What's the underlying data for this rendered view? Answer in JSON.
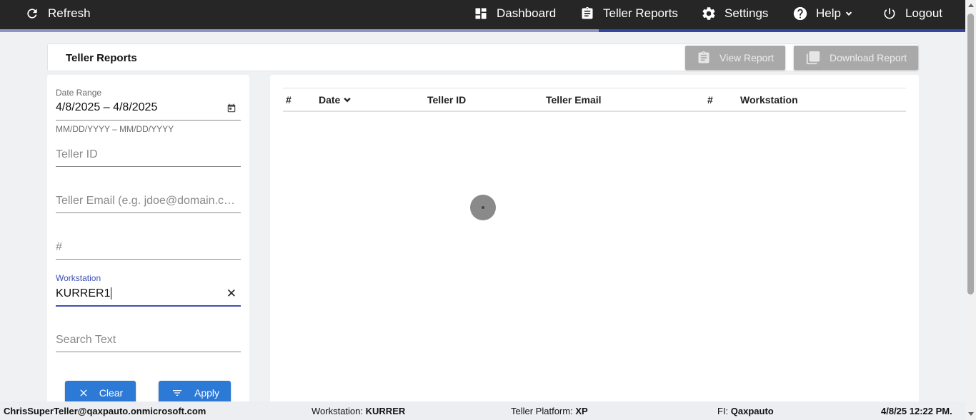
{
  "nav": {
    "refresh_label": "Refresh",
    "dashboard_label": "Dashboard",
    "teller_reports_label": "Teller Reports",
    "settings_label": "Settings",
    "help_label": "Help",
    "logout_label": "Logout",
    "active_item": "Teller Reports",
    "background_color": "#262626",
    "active_indicator_color": "#3545a3"
  },
  "header": {
    "title": "Teller Reports",
    "view_report_label": "View Report",
    "download_report_label": "Download Report"
  },
  "filters": {
    "date_range": {
      "label": "Date Range",
      "value": "4/8/2025 – 4/8/2025",
      "hint": "MM/DD/YYYY – MM/DD/YYYY"
    },
    "teller_id": {
      "placeholder": "Teller ID"
    },
    "teller_email": {
      "placeholder": "Teller Email (e.g. jdoe@domain.com)"
    },
    "number": {
      "placeholder": "#"
    },
    "workstation": {
      "label": "Workstation",
      "value": "KURRER1"
    },
    "search_text": {
      "placeholder": "Search Text"
    },
    "clear_label": "Clear",
    "apply_label": "Apply",
    "button_color": "#2d79d6"
  },
  "table": {
    "columns": [
      "#",
      "Date",
      "Teller ID",
      "Teller Email",
      "#",
      "Workstation"
    ],
    "sorted_column": "Date",
    "rows": []
  },
  "status": {
    "user": "ChrisSuperTeller@qaxpauto.onmicrosoft.com",
    "workstation_label": "Workstation:",
    "workstation_value": "KURRER",
    "platform_label": "Teller Platform:",
    "platform_value": "XP",
    "fi_label": "FI:",
    "fi_value": "Qaxpauto",
    "datetime": "4/8/25 12:22 PM."
  }
}
